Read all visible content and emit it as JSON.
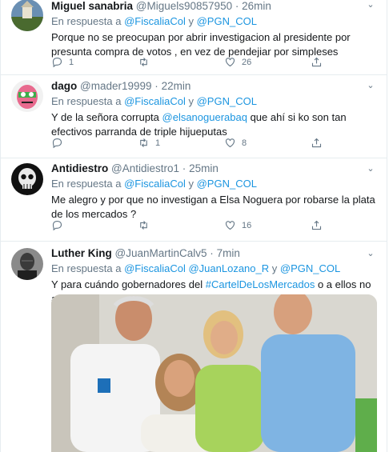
{
  "tweets": [
    {
      "name": "Miguel sanabria",
      "handle": "@Miguels90857950",
      "time": "26min",
      "reply_prefix": "En respuesta a",
      "reply_targets": [
        "@FiscaliaCol",
        "@PGN_COL"
      ],
      "reply_sep": [
        "y"
      ],
      "text": "Porque no se preocupan por abrir investigacion al presidente por presunta compra de votos , en vez de pendejiar por simpleses",
      "counts": {
        "reply": "1",
        "retweet": "",
        "like": "26"
      }
    },
    {
      "name": "dago",
      "handle": "@mader19999",
      "time": "22min",
      "reply_prefix": "En respuesta a",
      "reply_targets": [
        "@FiscaliaCol",
        "@PGN_COL"
      ],
      "reply_sep": [
        "y"
      ],
      "text_before": "Y de la señora corrupta ",
      "text_mention": "@elsanoguerabaq",
      "text_after": " que ahí si ko son tan efectivos parranda de triple hijueputas",
      "counts": {
        "reply": "",
        "retweet": "1",
        "like": "8"
      }
    },
    {
      "name": "Antidiestro",
      "handle": "@Antidiestro1",
      "time": "25min",
      "reply_prefix": "En respuesta a",
      "reply_targets": [
        "@FiscaliaCol",
        "@PGN_COL"
      ],
      "reply_sep": [
        "y"
      ],
      "text": "Me alegro y por que  no investigan a Elsa Noguera por robarse la plata de los mercados ?",
      "counts": {
        "reply": "",
        "retweet": "",
        "like": "16"
      }
    },
    {
      "name": "Luther King",
      "handle": "@JuanMartinCalv5",
      "time": "7min",
      "reply_prefix": "En respuesta a",
      "reply_targets": [
        "@FiscaliaCol",
        "@JuanLozano_R",
        "@PGN_COL"
      ],
      "reply_sep": [
        "y"
      ],
      "text_before": "Y para cuándo gobernadores del ",
      "text_hashtag": "#CartelDeLosMercados",
      "text_after": " o a ellos no aplica ?"
    }
  ],
  "common": {
    "dot": "·"
  },
  "colors": {
    "link": "#1b95e0",
    "muted": "#657786",
    "border": "#e6ecf0"
  },
  "icons": [
    "reply-icon",
    "retweet-icon",
    "like-icon",
    "share-icon",
    "chevron-down-icon"
  ]
}
